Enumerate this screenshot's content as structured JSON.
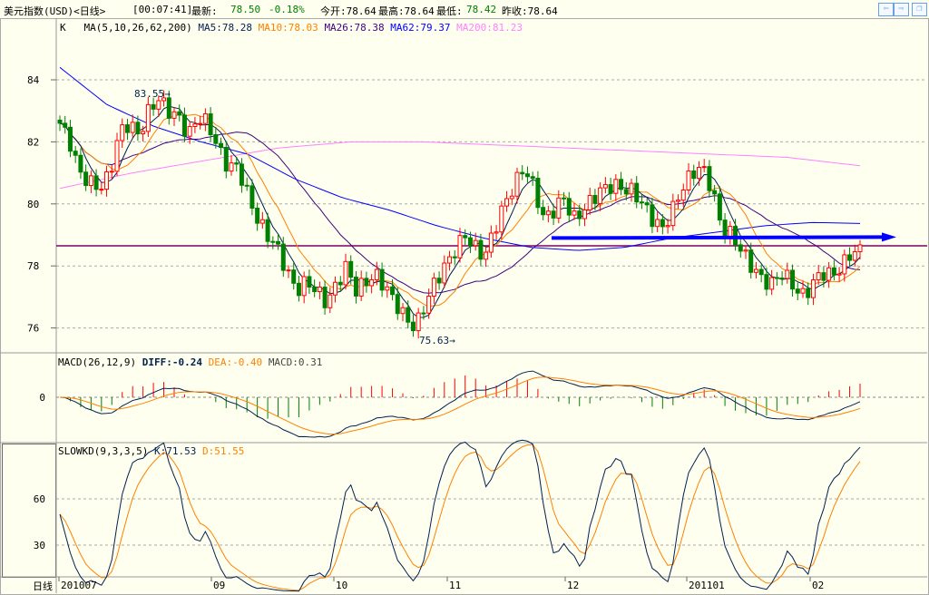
{
  "header": {
    "title": "美元指数(USD)<日线>",
    "time": "[00:07:41]",
    "latest_label": "最新:",
    "latest": "78.50",
    "change": "-0.18%",
    "open": "今开:78.64",
    "high": "最高:78.64",
    "low_label": "最低:",
    "low": "78.42",
    "prev": "昨收:78.64"
  },
  "buttons": {
    "prev": "⇦",
    "next": "⇨",
    "restore": "❐"
  },
  "ma_legend": {
    "k": "K",
    "ma": "MA(5,10,26,62,200)",
    "ma5": "MA5:78.28",
    "ma10": "MA10:78.03",
    "ma26": "MA26:78.38",
    "ma62": "MA62:79.37",
    "ma200": "MA200:81.23"
  },
  "macd_legend": {
    "name": "MACD(26,12,9)",
    "diff": "DIFF:-0.24",
    "dea": "DEA:-0.40",
    "macd": "MACD:0.31"
  },
  "kd_legend": {
    "name": "SLOWKD(9,3,3,5)",
    "k": "K:71.53",
    "d": "D:51.55"
  },
  "period_label": "日线",
  "colors": {
    "up": "#ff0000",
    "down": "#008000",
    "ma5": "#002050",
    "ma10": "#ff8000",
    "ma26": "#400080",
    "ma62": "#0000ff",
    "ma200": "#ff80ff"
  },
  "chart_data": {
    "type": "candlestick",
    "y_ticks": [
      "84",
      "82",
      "80",
      "78",
      "76"
    ],
    "macd_ticks": [
      "0"
    ],
    "kd_ticks": [
      "60",
      "30"
    ],
    "x_ticks": [
      "201007",
      "09",
      "10",
      "11",
      "12",
      "201101",
      "02"
    ],
    "annotations": {
      "high": "83.55",
      "low": "75.63"
    },
    "close_keypoints": [
      82.6,
      82.0,
      81.0,
      80.7,
      80.5,
      80.9,
      82.3,
      82.6,
      82.2,
      83.0,
      83.4,
      83.0,
      82.8,
      82.2,
      82.8,
      82.6,
      81.8,
      81.2,
      81.2,
      80.3,
      79.5,
      79.0,
      78.6,
      77.8,
      77.2,
      77.5,
      77.2,
      76.8,
      77.4,
      78.0,
      77.2,
      77.5,
      77.7,
      77.3,
      76.8,
      76.3,
      76.0,
      76.8,
      77.5,
      78.0,
      78.5,
      79.0,
      78.6,
      78.3,
      79.2,
      80.0,
      80.6,
      81.2,
      80.5,
      79.5,
      79.8,
      80.2,
      79.5,
      79.8,
      80.2,
      80.5,
      80.6,
      80.5,
      80.4,
      80.0,
      79.5,
      79.2,
      79.8,
      80.5,
      81.0,
      81.2,
      80.5,
      79.2,
      79.0,
      78.5,
      78.0,
      77.6,
      77.4,
      77.8,
      77.5,
      77.0,
      77.3,
      77.8,
      77.7,
      77.9,
      78.4,
      78.5
    ],
    "ma62_keypoints": [
      84.4,
      83.2,
      82.5,
      82.0,
      81.6,
      80.8,
      80.2,
      79.8,
      79.3,
      78.9,
      78.6,
      78.5,
      78.6,
      78.9,
      79.1,
      79.3,
      79.4,
      79.37
    ],
    "ma200_keypoints": [
      80.5,
      81.0,
      81.4,
      81.8,
      82.0,
      82.0,
      81.9,
      81.8,
      81.7,
      81.6,
      81.5,
      81.23
    ],
    "support_line": 78.65,
    "arrow_level": 78.9
  }
}
